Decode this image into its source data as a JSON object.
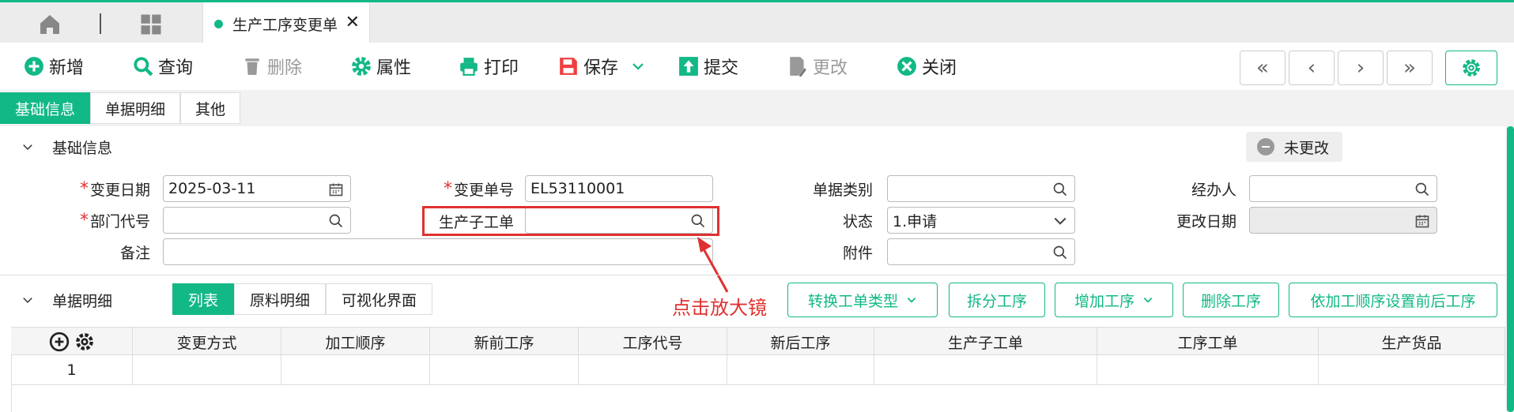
{
  "tabbar": {
    "tab_label": "生产工序变更单",
    "close_glyph": "✕",
    "icons": [
      "home-icon",
      "grid-icon",
      "close-icon"
    ]
  },
  "toolbar": {
    "add": "新增",
    "query": "查询",
    "delete": "删除",
    "props": "属性",
    "print": "打印",
    "save": "保存",
    "submit": "提交",
    "modify": "更改",
    "close": "关闭",
    "nav": [
      "«",
      "‹",
      "›",
      "»"
    ]
  },
  "section_tabs": [
    "基础信息",
    "单据明细",
    "其他"
  ],
  "basic": {
    "title": "基础信息",
    "status_badge": "未更改",
    "fields": {
      "change_date_label": "变更日期",
      "change_date_value": "2025-03-11",
      "change_no_label": "变更单号",
      "change_no_value": "EL53110001",
      "doc_type_label": "单据类别",
      "doc_type_value": "",
      "handler_label": "经办人",
      "handler_value": "",
      "dept_label": "部门代号",
      "dept_value": "",
      "sub_order_label": "生产子工单",
      "sub_order_value": "",
      "status_label": "状态",
      "status_value": "1.申请",
      "modify_date_label": "更改日期",
      "modify_date_value": "",
      "remark_label": "备注",
      "remark_value": "",
      "attachment_label": "附件",
      "attachment_value": ""
    }
  },
  "annotation": "点击放大镜",
  "detail": {
    "title": "单据明细",
    "tabs": [
      "列表",
      "原料明细",
      "可视化界面"
    ],
    "buttons": [
      "转换工单类型",
      "拆分工序",
      "增加工序",
      "删除工序",
      "依加工顺序设置前后工序"
    ],
    "columns": [
      "变更方式",
      "加工顺序",
      "新前工序",
      "工序代号",
      "新后工序",
      "生产子工单",
      "工序工单",
      "生产货品"
    ],
    "rows": [
      {
        "index": "1"
      }
    ]
  },
  "colors": {
    "accent": "#12b886",
    "required": "#e03131",
    "annotation": "#e03131"
  }
}
